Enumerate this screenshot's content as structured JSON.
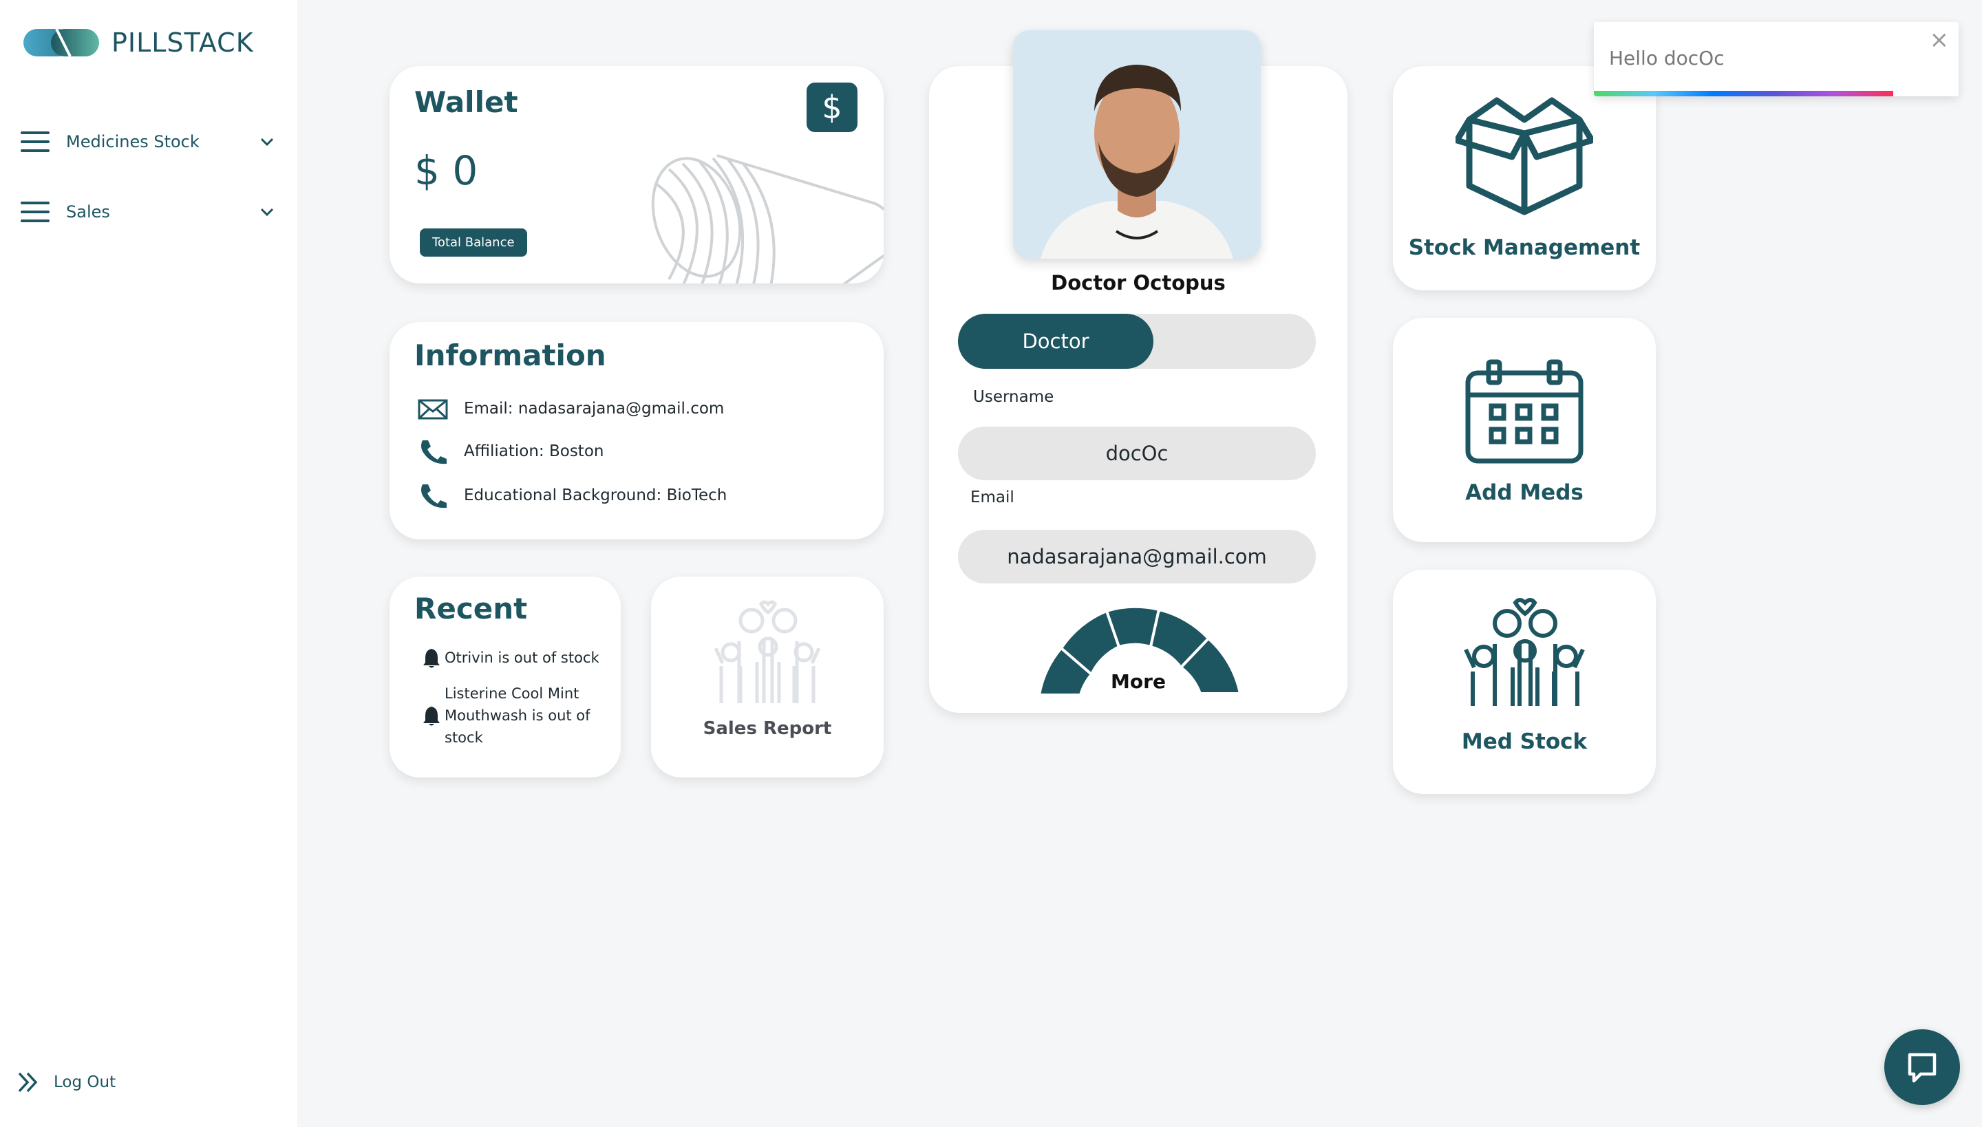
{
  "app": {
    "brand": "PILLSTACK"
  },
  "sidebar": {
    "items": [
      {
        "label": "Medicines Stock",
        "icon": "menu-icon"
      },
      {
        "label": "Sales",
        "icon": "menu-icon"
      }
    ],
    "logout_label": "Log Out"
  },
  "wallet": {
    "title": "Wallet",
    "amount": "$ 0",
    "badge": "Total Balance",
    "dollar_symbol": "$"
  },
  "information": {
    "title": "Information",
    "rows": [
      {
        "icon": "mail-icon",
        "text": "Email: nadasarajana@gmail.com"
      },
      {
        "icon": "phone-icon",
        "text": "Affiliation: Boston"
      },
      {
        "icon": "phone-icon",
        "text": "Educational Background: BioTech"
      }
    ]
  },
  "recent": {
    "title": "Recent",
    "items": [
      {
        "text": "Otrivin is out of stock"
      },
      {
        "line1": "Listerine Cool Mint",
        "line2": "Mouthwash is out of",
        "line3": "stock"
      }
    ]
  },
  "sales_report": {
    "label": "Sales Report"
  },
  "profile": {
    "name": "Doctor Octopus",
    "role": "Doctor",
    "username_label": "Username",
    "username": "docOc",
    "email_label": "Email",
    "email": "nadasarajana@gmail.com",
    "more_label": "More"
  },
  "tiles": {
    "stock_management": "Stock Management",
    "add_meds": "Add Meds",
    "med_stock": "Med Stock"
  },
  "toast": {
    "message": "Hello docOc",
    "close": "×",
    "progress": 0.82
  },
  "colors": {
    "primary": "#1d5560",
    "background": "#f4f6f8"
  }
}
